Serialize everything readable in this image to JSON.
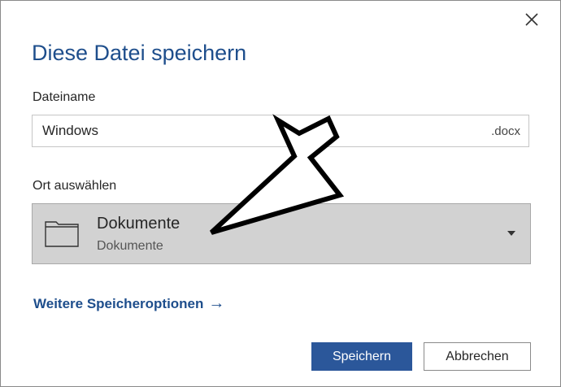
{
  "dialog": {
    "title": "Diese Datei speichern",
    "close_icon": "close-icon"
  },
  "filename": {
    "label": "Dateiname",
    "value": "Windows",
    "extension": ".docx"
  },
  "location": {
    "label": "Ort auswählen",
    "selected_title": "Dokumente",
    "selected_subtitle": "Dokumente",
    "icon": "folder-icon"
  },
  "more_options": {
    "label": "Weitere Speicheroptionen",
    "arrow": "→"
  },
  "buttons": {
    "save": "Speichern",
    "cancel": "Abbrechen"
  },
  "colors": {
    "accent": "#2b579a",
    "title": "#1e4e8c",
    "location_bg": "#d2d2d2"
  }
}
